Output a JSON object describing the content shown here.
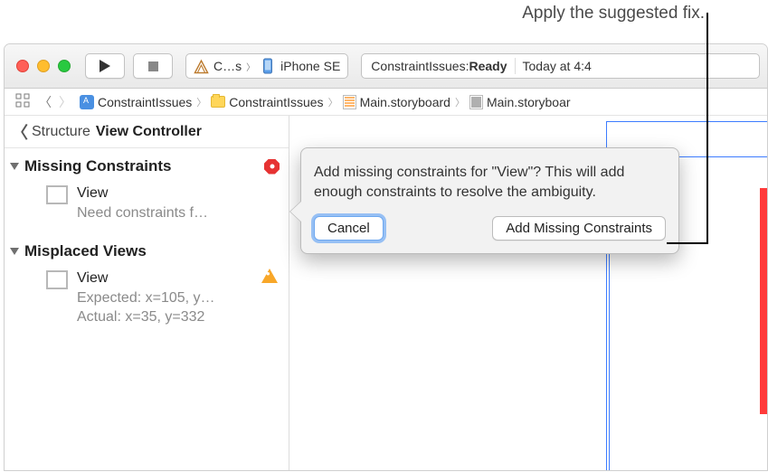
{
  "annotation": {
    "label": "Apply the suggested fix."
  },
  "toolbar": {
    "scheme_name": "C…s",
    "device_name": "iPhone SE",
    "status_project": "ConstraintIssues: ",
    "status_state": "Ready",
    "status_time": "Today at 4:4"
  },
  "breadcrumb": {
    "items": [
      {
        "label": "ConstraintIssues"
      },
      {
        "label": "ConstraintIssues"
      },
      {
        "label": "Main.storyboard"
      },
      {
        "label": "Main.storyboar"
      }
    ]
  },
  "outline": {
    "back_label": "Structure",
    "title": "View Controller",
    "sections": [
      {
        "title": "Missing Constraints",
        "badge": "error",
        "item_title": "View",
        "item_sub": "Need constraints f…"
      },
      {
        "title": "Misplaced Views",
        "badge": "warning",
        "item_title": "View",
        "item_sub_line1": "Expected: x=105, y…",
        "item_sub_line2": "Actual: x=35, y=332"
      }
    ]
  },
  "popover": {
    "message": "Add missing constraints for \"View\"? This will add enough constraints to resolve the ambiguity.",
    "cancel": "Cancel",
    "confirm": "Add Missing Constraints"
  },
  "colors": {
    "error_badge": "#e63232",
    "warning_badge": "#f8a729",
    "selection_blue": "#3d7cff",
    "misplaced_red": "#ff3a3a"
  }
}
